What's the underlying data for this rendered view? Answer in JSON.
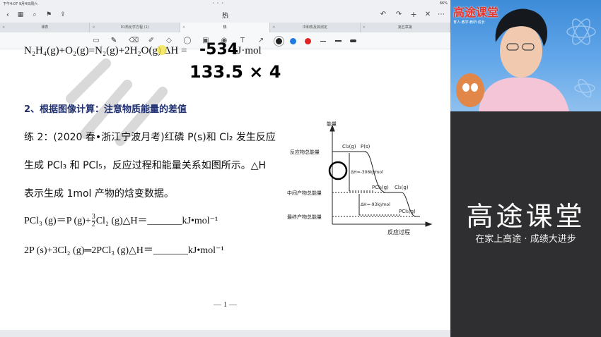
{
  "status_bar": {
    "time": "下午4:07  9月4日周六",
    "dots": "• • •",
    "battery": "66%"
  },
  "title_bar": {
    "title": "热",
    "back_icon": "chevron-left",
    "undo_icon": "undo",
    "redo_icon": "redo",
    "add_icon": "plus",
    "close_icon": "close",
    "more_icon": "more"
  },
  "tabs": [
    {
      "label": "课表",
      "active": false
    },
    {
      "label": "01热化学方程 (1)",
      "active": false
    },
    {
      "label": "热",
      "active": true
    },
    {
      "label": "中和热及其测定",
      "active": false
    },
    {
      "label": "第五章第",
      "active": false
    }
  ],
  "toolbar": {
    "pen_colors": [
      "#222222",
      "#1f7be0",
      "#e02424"
    ]
  },
  "document": {
    "line_eq_top": "N₂H₄(g)+O₂(g)=N₂(g)+2H₂O(g)   ΔH = ",
    "line_eq_unit": "kJ·mol",
    "handwriting_value": "-534",
    "handwriting_calc": "133.5 × 4",
    "section_heading": "2、根据图像计算：注意物质能量的差值",
    "problem_line1": "练 2：(2020 春•浙江宁波月考)红磷 P(s)和  Cl₂  发生反应",
    "problem_line2": "生成  PCl₃ 和  PCl₅，反应过程和能量关系如图所示。△H",
    "problem_line3": "表示生成  1mol 产物的焓变数据。",
    "eq1_left": "PCl₃ (g)＝P (g)+",
    "eq1_frac_num": "3",
    "eq1_frac_den": "2",
    "eq1_right": "Cl₂ (g)△H＝",
    "eq1_blank": "_______",
    "eq1_unit": "kJ•mol⁻¹",
    "eq2_left": "2P (s)+3Cl₂ (g)═2PCl₃ (g)△H＝",
    "eq2_blank": "_______",
    "eq2_unit": "kJ•mol⁻¹",
    "page_number": "— 1 —",
    "diagram": {
      "y_axis_label": "能量",
      "x_axis_label": "反应过程",
      "level_reactant": "反应物总能量",
      "level_intermediate": "中间产物总能量",
      "level_final": "最终产物总能量",
      "species_top_a": "Cl₂(g)",
      "species_top_b": "P(s)",
      "species_mid_a": "PCl₃(g)",
      "species_mid_b": "Cl₂(g)",
      "species_bottom": "PCl₅(g)",
      "dh1": "ΔH=-306kJ/mol",
      "dh2": "ΔH=-93kJ/mol"
    }
  },
  "brand": {
    "logo_text": "高途课堂",
    "logo_sub": "育人·教学·教研·成长",
    "panel_title": "高途课堂",
    "panel_slogan": "在家上高途 · 成绩大进步",
    "brand_color": "#e8352b"
  }
}
